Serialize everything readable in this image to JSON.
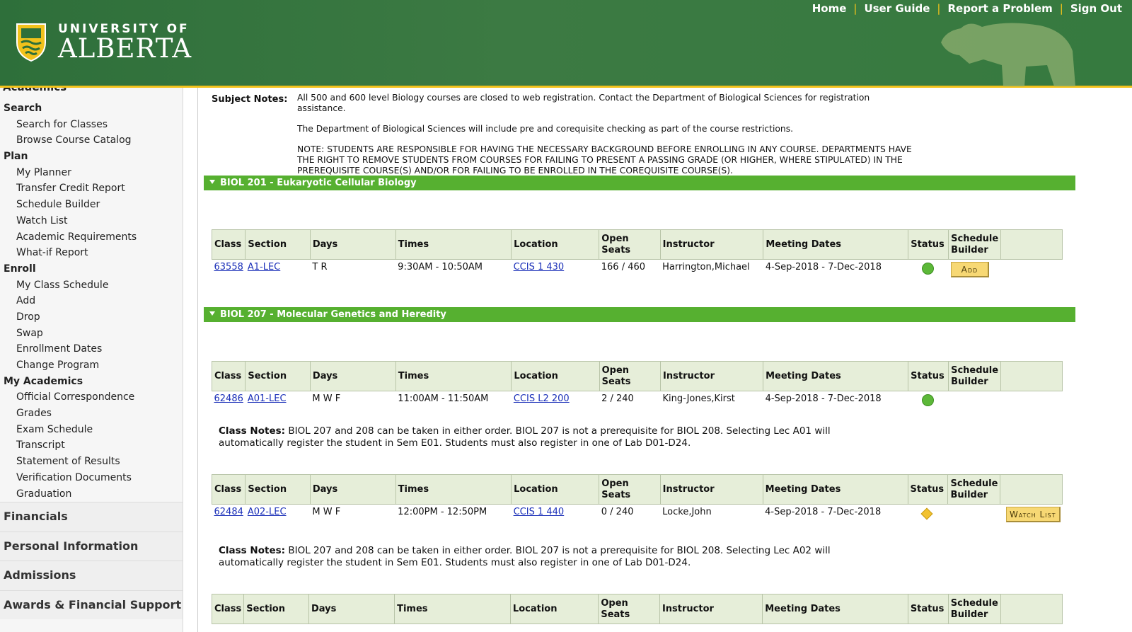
{
  "header": {
    "logo_line1": "UNIVERSITY OF",
    "logo_line2": "ALBERTA",
    "nav": [
      "Home",
      "User Guide",
      "Report a Problem",
      "Sign Out"
    ],
    "separator": "|",
    "colors": {
      "green": "#3c7a43",
      "gold": "#f2c21b"
    }
  },
  "sidebar": {
    "cut_heading": "Academics",
    "groups": [
      {
        "label": "Search",
        "items": [
          "Search for Classes",
          "Browse Course Catalog"
        ]
      },
      {
        "label": "Plan",
        "items": [
          "My Planner",
          "Transfer Credit Report",
          "Schedule Builder",
          "Watch List",
          "Academic Requirements",
          "What-if Report"
        ]
      },
      {
        "label": "Enroll",
        "items": [
          "My Class Schedule",
          "Add",
          "Drop",
          "Swap",
          "Enrollment Dates",
          "Change Program"
        ]
      },
      {
        "label": "My Academics",
        "items": [
          "Official Correspondence",
          "Grades",
          "Exam Schedule",
          "Transcript",
          "Statement of Results",
          "Verification Documents",
          "Graduation"
        ]
      }
    ],
    "sections": [
      "Financials",
      "Personal Information",
      "Admissions",
      "Awards & Financial Support"
    ]
  },
  "subject_notes": {
    "label": "Subject Notes:",
    "p1": "All 500 and 600 level Biology courses are closed to web registration. Contact the Department of Biological Sciences for registration assistance.",
    "p2": "The Department of Biological Sciences will include pre and corequisite checking as part of the course restrictions.",
    "p3": "NOTE: STUDENTS ARE RESPONSIBLE FOR HAVING THE NECESSARY BACKGROUND BEFORE ENROLLING IN ANY COURSE.  DEPARTMENTS HAVE THE RIGHT TO REMOVE STUDENTS FROM COURSES FOR FAILING TO PRESENT A PASSING GRADE (OR HIGHER, WHERE STIPULATED) IN THE PREREQUISITE COURSE(S) AND/OR FOR FAILING TO BE ENROLLED IN THE COREQUISITE COURSE(S)."
  },
  "table_headers": {
    "class": "Class",
    "section": "Section",
    "days": "Days",
    "times": "Times",
    "location": "Location",
    "open_seats": "Open Seats",
    "instructor": "Instructor",
    "meeting_dates": "Meeting Dates",
    "status": "Status",
    "schedule_builder": "Schedule Builder"
  },
  "courses": [
    {
      "title": "BIOL 201 - Eukaryotic Cellular Biology",
      "sections": [
        {
          "class": "63558",
          "section": "A1-LEC",
          "days": "T R",
          "times": "9:30AM - 10:50AM",
          "location": "CCIS 1 430",
          "open_seats": "166 / 460",
          "instructor": "Harrington,Michael",
          "meeting_dates": "4-Sep-2018 - 7-Dec-2018",
          "status": "open",
          "action": "Add"
        }
      ]
    },
    {
      "title": "BIOL 207 - Molecular Genetics and Heredity",
      "sections": [
        {
          "class": "62486",
          "section": "A01-LEC",
          "days": "M W F",
          "times": "11:00AM - 11:50AM",
          "location": "CCIS L2 200",
          "open_seats": "2 / 240",
          "instructor": "King-Jones,Kirst",
          "meeting_dates": "4-Sep-2018 - 7-Dec-2018",
          "status": "open",
          "action": "",
          "notes_label": "Class Notes:",
          "notes": "BIOL 207 and 208 can be taken in either order. BIOL 207 is not a prerequisite for BIOL 208. Selecting Lec A01 will automatically register the student in Sem E01. Students must also register in one of Lab D01-D24."
        },
        {
          "class": "62484",
          "section": "A02-LEC",
          "days": "M W F",
          "times": "12:00PM - 12:50PM",
          "location": "CCIS 1 440",
          "open_seats": "0 / 240",
          "instructor": "Locke,John",
          "meeting_dates": "4-Sep-2018 - 7-Dec-2018",
          "status": "waitlist",
          "action": "Watch List",
          "notes_label": "Class Notes:",
          "notes": "BIOL 207 and 208 can be taken in either order. BIOL 207 is not a prerequisite for BIOL 208. Selecting Lec A02 will automatically register the student in Sem E01. Students must also register in one of Lab D01-D24."
        }
      ]
    }
  ]
}
